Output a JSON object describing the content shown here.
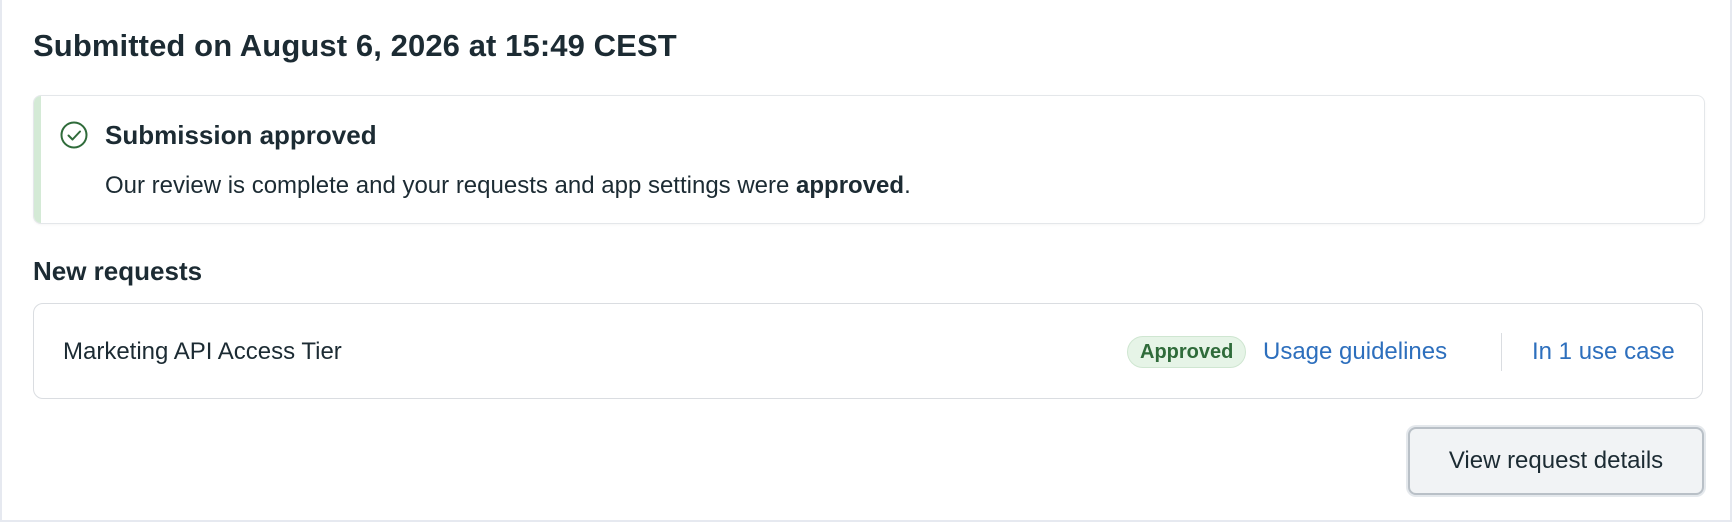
{
  "header": {
    "title": "Submitted on August 6, 2026 at 15:49 CEST"
  },
  "alert": {
    "icon": "check-circle-icon",
    "title": "Submission approved",
    "body_prefix": "Our review is complete and your requests and app settings were ",
    "body_emphasis": "approved",
    "body_suffix": "."
  },
  "requests": {
    "section_title": "New requests",
    "items": [
      {
        "name": "Marketing API Access Tier",
        "status": "Approved",
        "usage_link": "Usage guidelines",
        "use_case_link": "In 1 use case"
      }
    ]
  },
  "actions": {
    "view_details_label": "View request details"
  },
  "colors": {
    "text": "#1c2b33",
    "link": "#2d6fbd",
    "approved_text": "#2f6b3a",
    "approved_bg": "#e6f4e7",
    "alert_accent": "#d4ead6",
    "icon_green": "#2f6b3a"
  }
}
